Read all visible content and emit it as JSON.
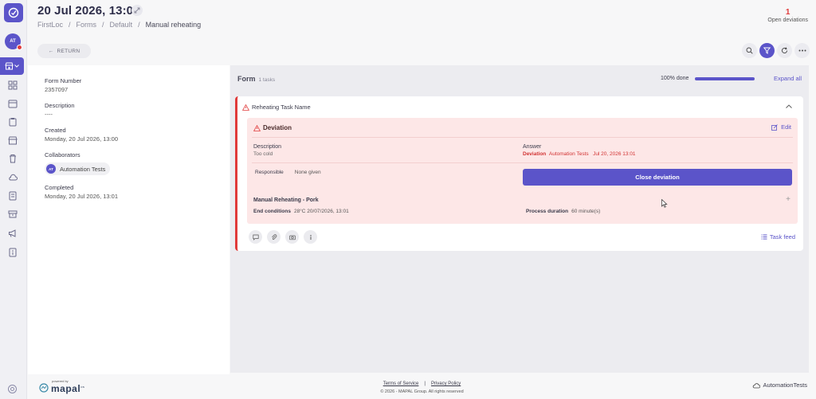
{
  "header": {
    "date_title": "20 Jul 2026, 13:00",
    "breadcrumbs": [
      "FirstLoc",
      "Forms",
      "Default",
      "Manual reheating"
    ],
    "open_deviations_count": "1",
    "open_deviations_label": "Open deviations",
    "return_label": "RETURN"
  },
  "sidebar": {
    "avatar_initials": "AT"
  },
  "info": {
    "form_number_label": "Form Number",
    "form_number": "2357097",
    "description_label": "Description",
    "description": "----",
    "created_label": "Created",
    "created": "Monday, 20 Jul 2026, 13:00",
    "collaborators_label": "Collaborators",
    "collaborator_initials": "AT",
    "collaborator_name": "Automation Tests",
    "completed_label": "Completed",
    "completed": "Monday, 20 Jul 2026, 13:01"
  },
  "form": {
    "title": "Form",
    "tasks_count": "1 tasks",
    "progress_label": "100% done",
    "progress": 1.0,
    "expand_all": "Expand all"
  },
  "task": {
    "name": "Reheating Task Name",
    "deviation": {
      "title": "Deviation",
      "edit": "Edit",
      "description_label": "Description",
      "description": "Too cold",
      "answer_label": "Answer",
      "answer_type": "Deviation",
      "answer_user": "Automation Tests",
      "answer_date": "Jul 20, 2026 13:01",
      "responsible_label": "Responsible",
      "responsible": "None given",
      "close_button": "Close deviation",
      "subtask_title": "Manual Reheating - Pork",
      "end_conditions_label": "End conditions",
      "end_conditions": "28°C 20/07/2026, 13:01",
      "process_duration_label": "Process duration",
      "process_duration": "60 minute(s)"
    },
    "task_feed": "Task feed"
  },
  "footer": {
    "powered_by": "powered by",
    "brand": "mapal",
    "brand_suffix": "os",
    "terms": "Terms of Service",
    "privacy": "Privacy Policy",
    "copyright": "© 2026 - MAPAL Group. All rights reserved",
    "user": "AutomationTests"
  },
  "colors": {
    "accent": "#5b54c9",
    "danger": "#e03a3a",
    "deviation_bg": "#fde7e7"
  }
}
